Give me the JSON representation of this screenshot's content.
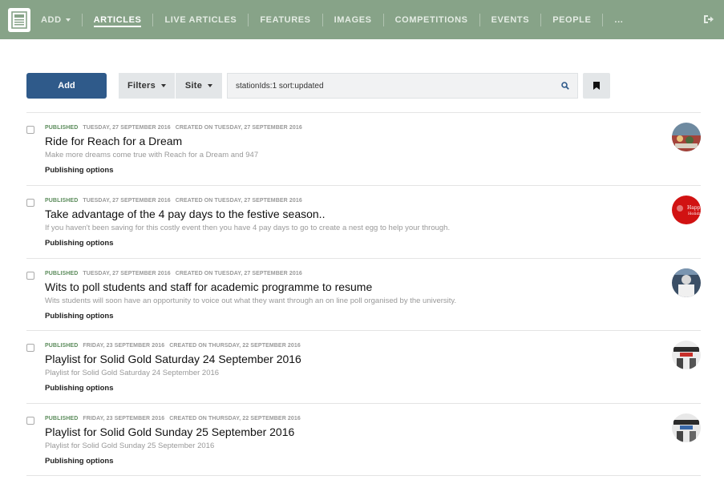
{
  "nav": {
    "items": [
      {
        "label": "ADD",
        "dropdown": true,
        "active": false
      },
      {
        "label": "ARTICLES",
        "dropdown": false,
        "active": true
      },
      {
        "label": "LIVE ARTICLES",
        "dropdown": false,
        "active": false
      },
      {
        "label": "FEATURES",
        "dropdown": false,
        "active": false
      },
      {
        "label": "IMAGES",
        "dropdown": false,
        "active": false
      },
      {
        "label": "COMPETITIONS",
        "dropdown": false,
        "active": false
      },
      {
        "label": "EVENTS",
        "dropdown": false,
        "active": false
      },
      {
        "label": "PEOPLE",
        "dropdown": false,
        "active": false
      },
      {
        "label": "...",
        "dropdown": false,
        "active": false
      }
    ],
    "logo_icon": "newspaper-icon",
    "logout_icon": "sign-out-icon"
  },
  "toolbar": {
    "add_label": "Add",
    "filters_label": "Filters",
    "site_label": "Site",
    "search_value": "stationIds:1 sort:updated",
    "search_icon": "search-icon",
    "bookmark_icon": "bookmark-icon"
  },
  "articles": [
    {
      "status": "PUBLISHED",
      "updated": "TUESDAY, 27 SEPTEMBER 2016",
      "created": "CREATED ON TUESDAY, 27 SEPTEMBER 2016",
      "title": "Ride for Reach for a Dream",
      "summary": "Make more dreams come true with Reach for a Dream and 947",
      "publishing_options": "Publishing options"
    },
    {
      "status": "PUBLISHED",
      "updated": "TUESDAY, 27 SEPTEMBER 2016",
      "created": "CREATED ON TUESDAY, 27 SEPTEMBER 2016",
      "title": "Take advantage of the 4 pay days to the festive season..",
      "summary": "If you haven't been saving for this costly event then you have 4 pay days to go to create a nest egg to help your through.",
      "publishing_options": "Publishing options"
    },
    {
      "status": "PUBLISHED",
      "updated": "TUESDAY, 27 SEPTEMBER 2016",
      "created": "CREATED ON TUESDAY, 27 SEPTEMBER 2016",
      "title": "Wits to poll students and staff for academic programme to resume",
      "summary": "Wits students will soon have an opportunity to voice out what they want through an on line poll organised by the university.",
      "publishing_options": "Publishing options"
    },
    {
      "status": "PUBLISHED",
      "updated": "FRIDAY, 23 SEPTEMBER 2016",
      "created": "CREATED ON THURSDAY, 22 SEPTEMBER 2016",
      "title": "Playlist for Solid Gold Saturday 24 September 2016",
      "summary": "Playlist for Solid Gold Saturday 24 September 2016",
      "publishing_options": "Publishing options"
    },
    {
      "status": "PUBLISHED",
      "updated": "FRIDAY, 23 SEPTEMBER 2016",
      "created": "CREATED ON THURSDAY, 22 SEPTEMBER 2016",
      "title": "Playlist for Solid Gold Sunday 25 September 2016",
      "summary": "Playlist for Solid Gold Sunday 25 September 2016",
      "publishing_options": "Publishing options"
    }
  ],
  "colors": {
    "nav_bg": "#87a388",
    "add_button": "#2f5a8a",
    "status_published": "#5c8c5c"
  }
}
